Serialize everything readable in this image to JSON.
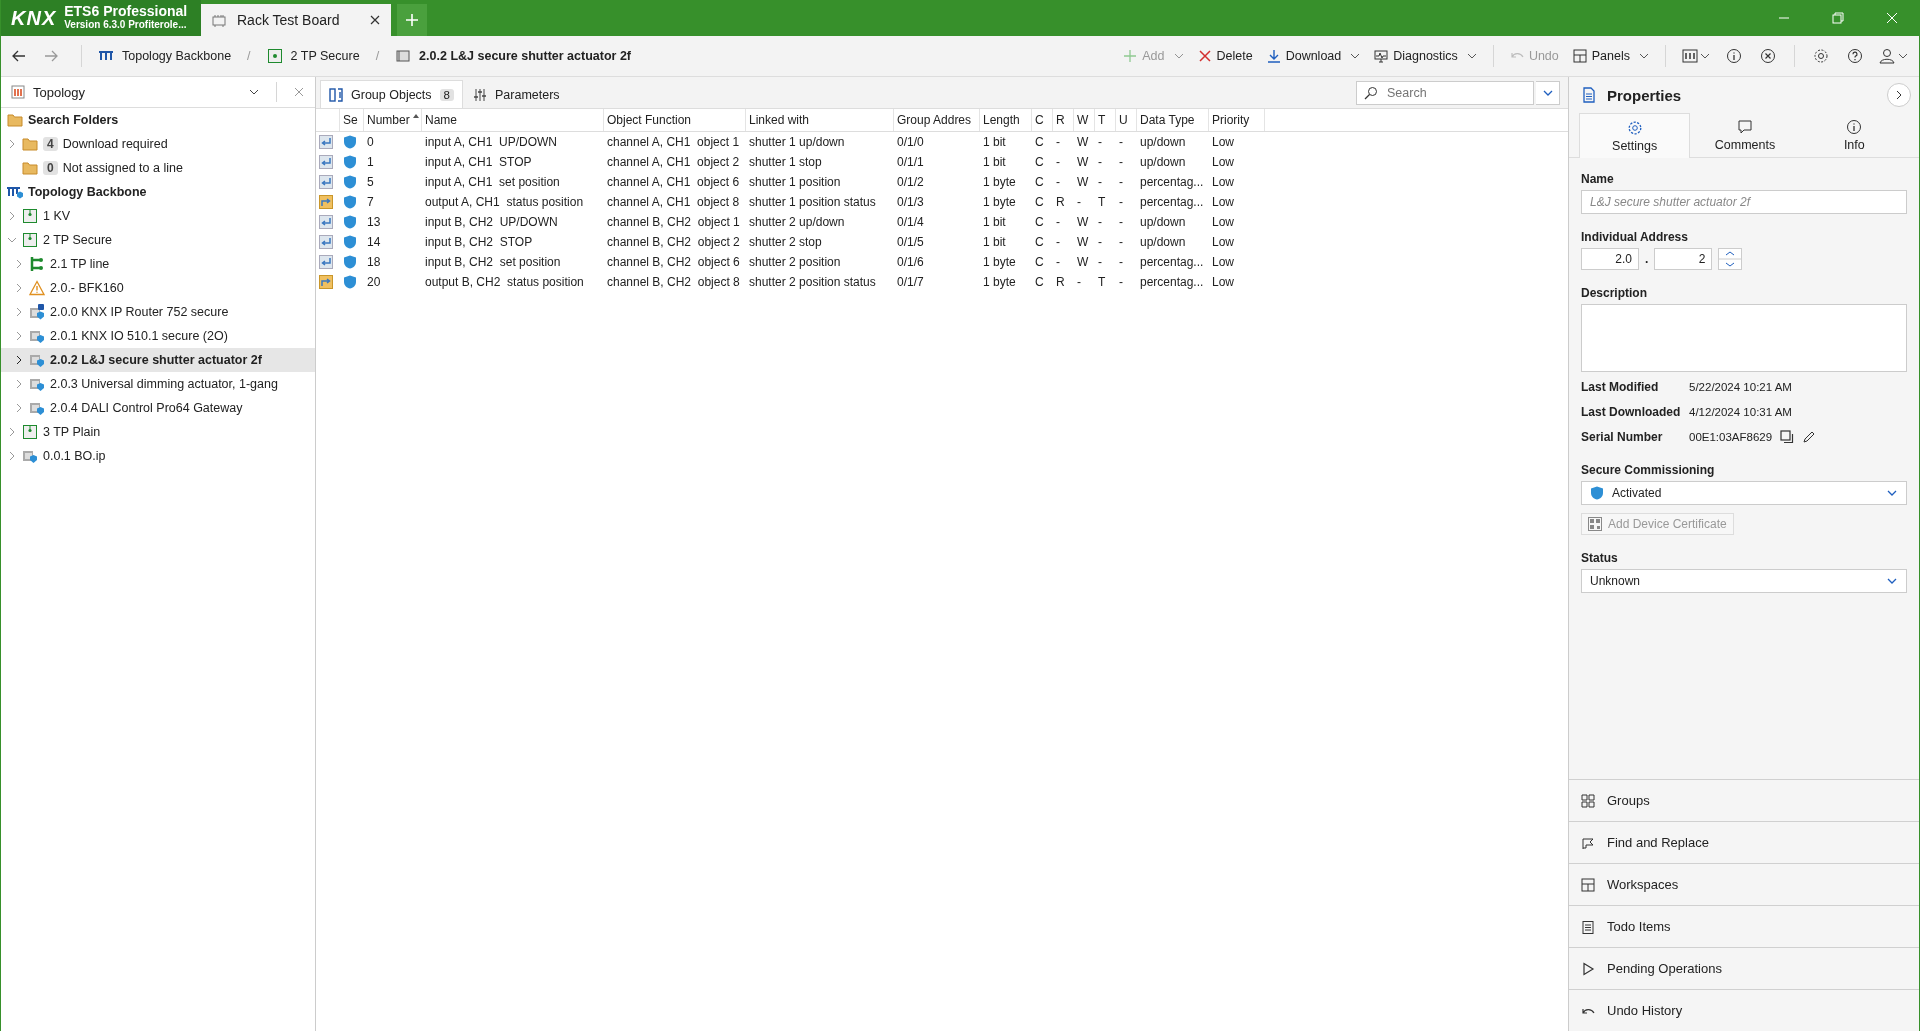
{
  "title_bar": {
    "logo": "KNX",
    "app_name": "ETS6 Professional",
    "version": "Version 6.3.0 Profiterole...",
    "tabs": [
      {
        "label": "Rack Test Board",
        "selected": true
      }
    ]
  },
  "toolbar": {
    "separator": "/",
    "breadcrumbs": [
      {
        "label": "Topology Backbone",
        "kind": "backbone",
        "current": false
      },
      {
        "label": "2 TP Secure",
        "kind": "area",
        "current": false
      },
      {
        "label": "2.0.2 L&J secure shutter actuator 2f",
        "kind": "device",
        "current": true
      }
    ],
    "actions": [
      {
        "label": "Add",
        "kind": "add",
        "disabled": true,
        "dropdown": true
      },
      {
        "label": "Delete",
        "kind": "delete",
        "disabled": false,
        "dropdown": false
      },
      {
        "label": "Download",
        "kind": "download",
        "disabled": false,
        "dropdown": true
      },
      {
        "label": "Diagnostics",
        "kind": "diagnostics",
        "disabled": false,
        "dropdown": true
      },
      {
        "label": "Undo",
        "kind": "undo",
        "disabled": true,
        "dropdown": false
      },
      {
        "label": "Panels",
        "kind": "panels",
        "disabled": false,
        "dropdown": true
      }
    ]
  },
  "topology": {
    "title": "Topology",
    "tree": [
      {
        "label": "Search Folders",
        "kind": "folder",
        "selected": false,
        "children": [
          {
            "label": "Download required",
            "kind": "folder",
            "badge": "4",
            "expanded": false,
            "selected": false
          },
          {
            "label": "Not assigned to a line",
            "kind": "folder",
            "badge": "0",
            "selected": false
          }
        ]
      },
      {
        "label": "Topology Backbone",
        "kind": "backbone",
        "selected": false,
        "children": [
          {
            "label": "1 KV",
            "kind": "area",
            "expanded": false,
            "selected": false
          },
          {
            "label": "2 TP Secure",
            "kind": "area",
            "expanded": true,
            "selected": false,
            "children": [
              {
                "label": "2.1 TP line",
                "kind": "line",
                "expanded": false,
                "selected": false
              },
              {
                "label": "2.0.- BFK160",
                "kind": "warning",
                "expanded": false,
                "selected": false
              },
              {
                "label": "2.0.0 KNX IP Router 752 secure",
                "kind": "router",
                "expanded": false,
                "selected": false
              },
              {
                "label": "2.0.1 KNX IO 510.1 secure (2O)",
                "kind": "device",
                "expanded": false,
                "selected": false
              },
              {
                "label": "2.0.2 L&J secure shutter actuator 2f",
                "kind": "device",
                "expanded": false,
                "selected": true
              },
              {
                "label": "2.0.3 Universal dimming actuator, 1-gang",
                "kind": "device",
                "expanded": false,
                "selected": false
              },
              {
                "label": "2.0.4 DALI Control Pro64 Gateway",
                "kind": "device",
                "expanded": false,
                "selected": false
              }
            ]
          },
          {
            "label": "3 TP Plain",
            "kind": "area",
            "expanded": false,
            "selected": false
          },
          {
            "label": "0.0.1 BO.ip",
            "kind": "device",
            "expanded": false,
            "selected": false
          }
        ]
      }
    ]
  },
  "editor": {
    "tabs": [
      {
        "label": "Group Objects",
        "kind": "group-objects",
        "count": "8",
        "selected": true
      },
      {
        "label": "Parameters",
        "kind": "parameters",
        "selected": false
      }
    ],
    "search": {
      "placeholder": "Search"
    },
    "table": {
      "columns": [
        {
          "label": "Se",
          "sorted": false
        },
        {
          "label": "Number",
          "sorted": true
        },
        {
          "label": "Name",
          "sorted": false
        },
        {
          "label": "Object Function",
          "sorted": false
        },
        {
          "label": "Linked with",
          "sorted": false
        },
        {
          "label": "Group Addres",
          "sorted": false
        },
        {
          "label": "Length",
          "sorted": false
        },
        {
          "label": "C",
          "sorted": false
        },
        {
          "label": "R",
          "sorted": false
        },
        {
          "label": "W",
          "sorted": false
        },
        {
          "label": "T",
          "sorted": false
        },
        {
          "label": "U",
          "sorted": false
        },
        {
          "label": "Data Type",
          "sorted": false
        },
        {
          "label": "Priority",
          "sorted": false
        }
      ],
      "rows": [
        {
          "kind": "write",
          "cells": [
            "",
            "0",
            "input A, CH1  UP/DOWN",
            "channel A, CH1  object 1",
            "shutter 1 up/down",
            "0/1/0",
            "1 bit",
            "C",
            "-",
            "W",
            "-",
            "-",
            "up/down",
            "Low"
          ]
        },
        {
          "kind": "write",
          "cells": [
            "",
            "1",
            "input A, CH1  STOP",
            "channel A, CH1  object 2",
            "shutter 1 stop",
            "0/1/1",
            "1 bit",
            "C",
            "-",
            "W",
            "-",
            "-",
            "up/down",
            "Low"
          ]
        },
        {
          "kind": "write",
          "cells": [
            "",
            "5",
            "input A, CH1  set position",
            "channel A, CH1  object 6",
            "shutter 1 position",
            "0/1/2",
            "1 byte",
            "C",
            "-",
            "W",
            "-",
            "-",
            "percentag...",
            "Low"
          ]
        },
        {
          "kind": "status",
          "cells": [
            "",
            "7",
            "output A, CH1  status position",
            "channel A, CH1  object 8",
            "shutter 1 position status",
            "0/1/3",
            "1 byte",
            "C",
            "R",
            "-",
            "T",
            "-",
            "percentag...",
            "Low"
          ]
        },
        {
          "kind": "write",
          "cells": [
            "",
            "13",
            "input B, CH2  UP/DOWN",
            "channel B, CH2  object 1",
            "shutter 2 up/down",
            "0/1/4",
            "1 bit",
            "C",
            "-",
            "W",
            "-",
            "-",
            "up/down",
            "Low"
          ]
        },
        {
          "kind": "write",
          "cells": [
            "",
            "14",
            "input B, CH2  STOP",
            "channel B, CH2  object 2",
            "shutter 2 stop",
            "0/1/5",
            "1 bit",
            "C",
            "-",
            "W",
            "-",
            "-",
            "up/down",
            "Low"
          ]
        },
        {
          "kind": "write",
          "cells": [
            "",
            "18",
            "input B, CH2  set position",
            "channel B, CH2  object 6",
            "shutter 2 position",
            "0/1/6",
            "1 byte",
            "C",
            "-",
            "W",
            "-",
            "-",
            "percentag...",
            "Low"
          ]
        },
        {
          "kind": "status",
          "cells": [
            "",
            "20",
            "output B, CH2  status position",
            "channel B, CH2  object 8",
            "shutter 2 position status",
            "0/1/7",
            "1 byte",
            "C",
            "R",
            "-",
            "T",
            "-",
            "percentag...",
            "Low"
          ]
        }
      ]
    }
  },
  "properties": {
    "title": "Properties",
    "tabs": [
      {
        "label": "Settings",
        "kind": "settings",
        "selected": true
      },
      {
        "label": "Comments",
        "kind": "comments",
        "selected": false
      },
      {
        "label": "Info",
        "kind": "info",
        "selected": false
      }
    ],
    "name": {
      "label": "Name",
      "placeholder": "L&J secure shutter actuator 2f"
    },
    "address": {
      "label": "Individual Address",
      "line": "2.0",
      "separator": ".",
      "device": "2"
    },
    "description": {
      "label": "Description"
    },
    "info": [
      {
        "label": "Last Modified",
        "value": "5/22/2024 10:21 AM",
        "kind": "text"
      },
      {
        "label": "Last Downloaded",
        "value": "4/12/2024 10:31 AM",
        "kind": "text"
      },
      {
        "label": "Serial Number",
        "value": "00E1:03AF8629",
        "kind": "serial"
      }
    ],
    "secure_commissioning": {
      "label": "Secure Commissioning",
      "value": "Activated"
    },
    "add_certificate": {
      "label": "Add Device Certificate",
      "disabled": true
    },
    "status": {
      "label": "Status",
      "value": "Unknown"
    }
  },
  "panels": [
    {
      "label": "Groups",
      "kind": "groups"
    },
    {
      "label": "Find and Replace",
      "kind": "find"
    },
    {
      "label": "Workspaces",
      "kind": "workspaces"
    },
    {
      "label": "Todo Items",
      "kind": "todo"
    },
    {
      "label": "Pending Operations",
      "kind": "pending"
    },
    {
      "label": "Undo History",
      "kind": "history"
    }
  ]
}
